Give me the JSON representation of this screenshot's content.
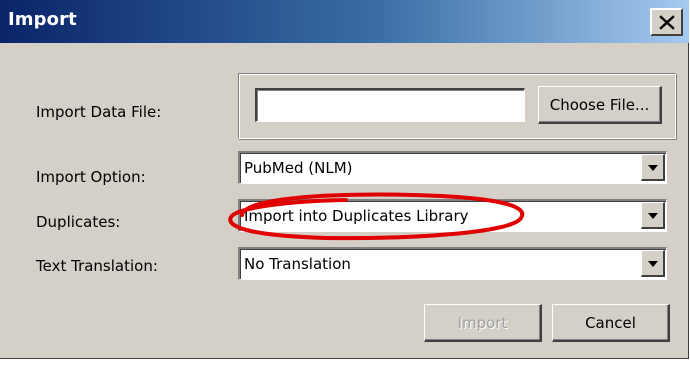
{
  "window": {
    "title": "Import",
    "close_symbol": "close-icon"
  },
  "form": {
    "import_data_file_label": "Import Data File:",
    "import_data_file_value": "",
    "choose_file_label": "Choose File...",
    "import_option_label": "Import Option:",
    "import_option_value": "PubMed (NLM)",
    "duplicates_label": "Duplicates:",
    "duplicates_value": "Import into Duplicates Library",
    "text_translation_label": "Text Translation:",
    "text_translation_value": "No Translation"
  },
  "buttons": {
    "import_label": "Import",
    "cancel_label": "Cancel"
  },
  "annotation": {
    "highlight_target": "Duplicates",
    "highlight_color": "#e00000"
  },
  "colors": {
    "title_gradient_start": "#0a246a",
    "title_gradient_end": "#a6caf0",
    "dialog_background": "#d4d0c8",
    "disabled_text": "#a0a0a0"
  }
}
